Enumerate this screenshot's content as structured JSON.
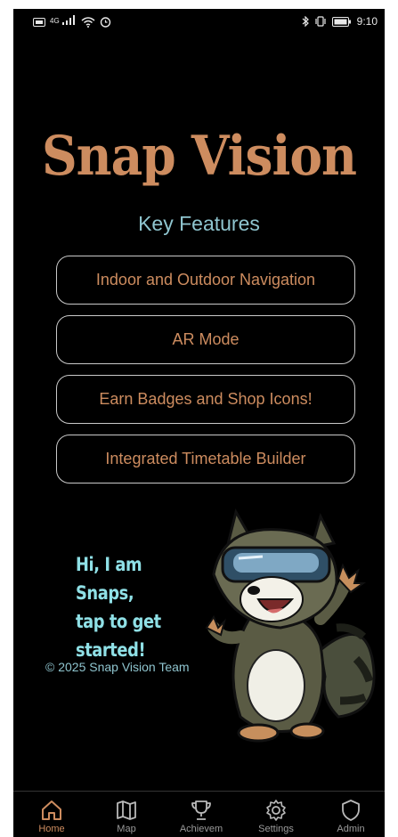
{
  "status_bar": {
    "left_icons": [
      "nfc-icon",
      "4g-signal-icon",
      "wifi-icon",
      "alarm-icon"
    ],
    "network": "4G",
    "right_icons": [
      "bluetooth-icon",
      "vibrate-icon",
      "battery-icon"
    ],
    "time": "9:10"
  },
  "app": {
    "title": "Snap Vision",
    "features_heading": "Key Features",
    "features": [
      {
        "label": "Indoor and Outdoor Navigation"
      },
      {
        "label": "AR Mode"
      },
      {
        "label": "Earn Badges and Shop Icons!"
      },
      {
        "label": "Integrated Timetable Builder"
      }
    ],
    "speech_lines": [
      "Hi, I am Snaps,",
      "tap to get",
      "started!"
    ],
    "copyright": "© 2025 Snap Vision Team",
    "mascot_icon": "raccoon-mascot-vr-goggles"
  },
  "bottom_nav": {
    "items": [
      {
        "label": "Home",
        "icon": "home-icon",
        "active": true
      },
      {
        "label": "Map",
        "icon": "map-icon",
        "active": false
      },
      {
        "label": "Achievem",
        "icon": "trophy-icon",
        "active": false
      },
      {
        "label": "Settings",
        "icon": "gear-icon",
        "active": false
      },
      {
        "label": "Admin",
        "icon": "shield-icon",
        "active": false
      }
    ]
  },
  "colors": {
    "background": "#000000",
    "title_accent": "#cd8c5f",
    "heading_teal": "#8fc5cf",
    "speech_teal": "#8fe0e6",
    "button_border": "#c9c9c9"
  }
}
